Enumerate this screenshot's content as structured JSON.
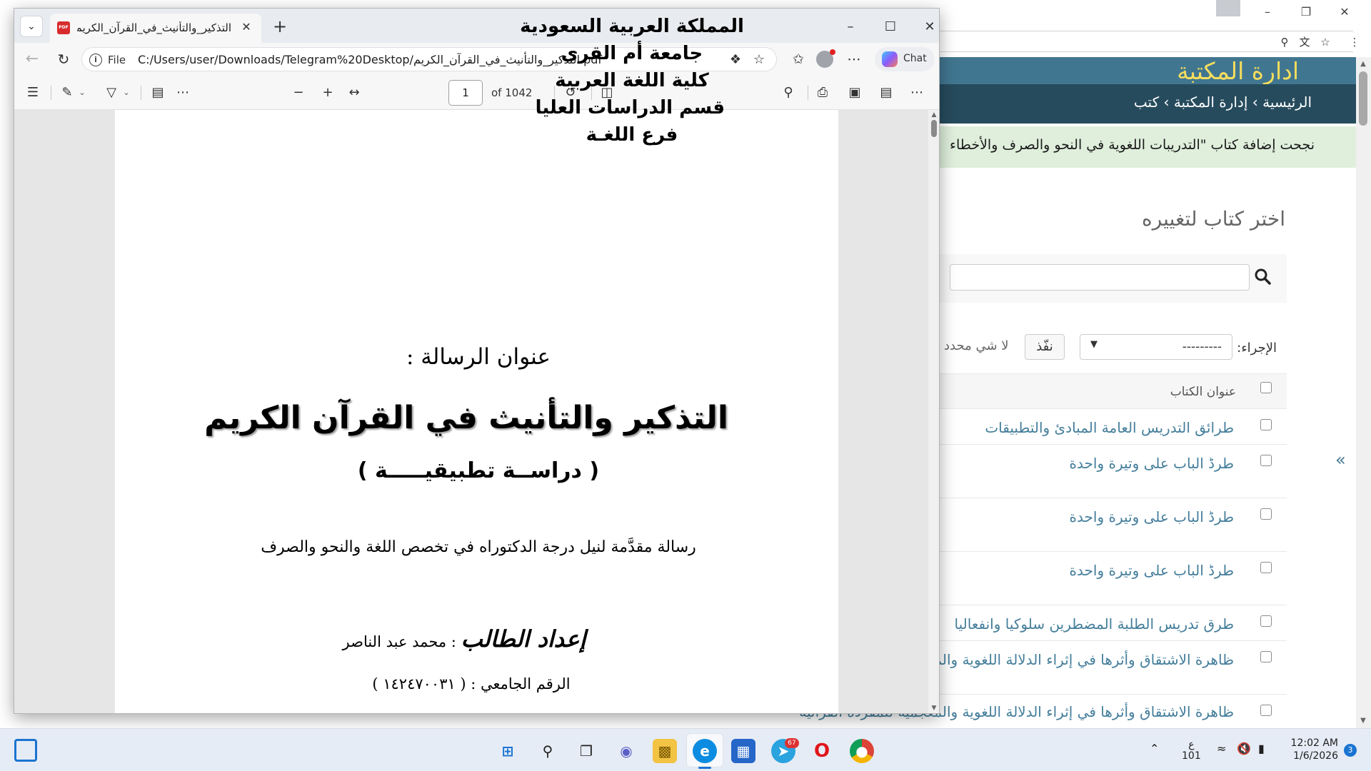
{
  "background_browser": {
    "brand_title": "ادارة المكتبة",
    "breadcrumbs": "الرئيسية › إدارة المكتبة › كتب",
    "success_message": "نجحت إضافة كتاب \"التدريبات اللغوية في النحو والصرف والأخطاء",
    "heading": "اختر كتاب لتغييره",
    "action_label": "الإجراء:",
    "action_select_value": "---------",
    "go_button": "نفّذ",
    "selected_count": "لا شي محدد",
    "column_header": "عنوان الكتاب",
    "books": [
      "طرائق التدريس العامة المبادئ والتطبيقات",
      "طرڈ الباب على وتيرة واحدة",
      "طرڈ الباب على وتيرة واحدة",
      "طرڈ الباب على وتيرة واحدة",
      "طرق تدريس الطلبة المضطرين سلوكيا وانفعاليا",
      "ظاهرة الاشتقاق وأثرها في إثراء الدلالة اللغوية والم",
      "ظاهرة الاشتقاق وأثرها في إثراء الدلالة اللغوية والمعجمية للمفردة القرآنية"
    ]
  },
  "pdf_viewer": {
    "tab_title": "التذكير_والتأنيث_في_القرآن_الكريم.pdf",
    "address_scheme": "File",
    "address_url": "C:/Users/user/Downloads/Telegram%20Desktop/التذكير_والتأنيث_في_القرآن_الكريم.pdf",
    "chat_label": "Chat",
    "page_number": "1",
    "page_count": "of 1042"
  },
  "pdf_page": {
    "institution": [
      "المملكة العربية السعودية",
      "جامعة أم القرى",
      "كلية اللغة العربية",
      "قسم الدراسات العليا",
      "فرع اللغـة"
    ],
    "title_label": "عنوان الرسالة :",
    "title": "التذكير والتأنيث في القرآن الكريم",
    "subtitle": "( دراســة تطبيقيـــــة )",
    "purpose": "رسالة مقدَّمة لنيل درجة الدكتوراه في تخصص اللغة والنحو والصرف",
    "student_label": "إعداد الطالب",
    "student_name": ": محمد عبد الناصر",
    "student_id": "الرقم الجامعي : ( ١٤٢٤٧٠٠٣١ )"
  },
  "taskbar": {
    "telegram_badge": "67",
    "input_lang": "ع",
    "input_lang_sub": "101",
    "time": "12:02 AM",
    "date": "1/6/2026",
    "notifications": "3"
  },
  "icons": {
    "start": "windows-start-icon",
    "search": "search-icon",
    "edge": "edge-icon",
    "telegram": "telegram-icon",
    "chrome": "chrome-icon"
  },
  "colors": {
    "admin_brand": "#417690",
    "admin_breadcrumbs": "#264b5d",
    "admin_brand_text": "#f5dd5d",
    "admin_link": "#447e9b",
    "success_bg": "#dfefdc",
    "taskbar": "#e6ecf5"
  }
}
